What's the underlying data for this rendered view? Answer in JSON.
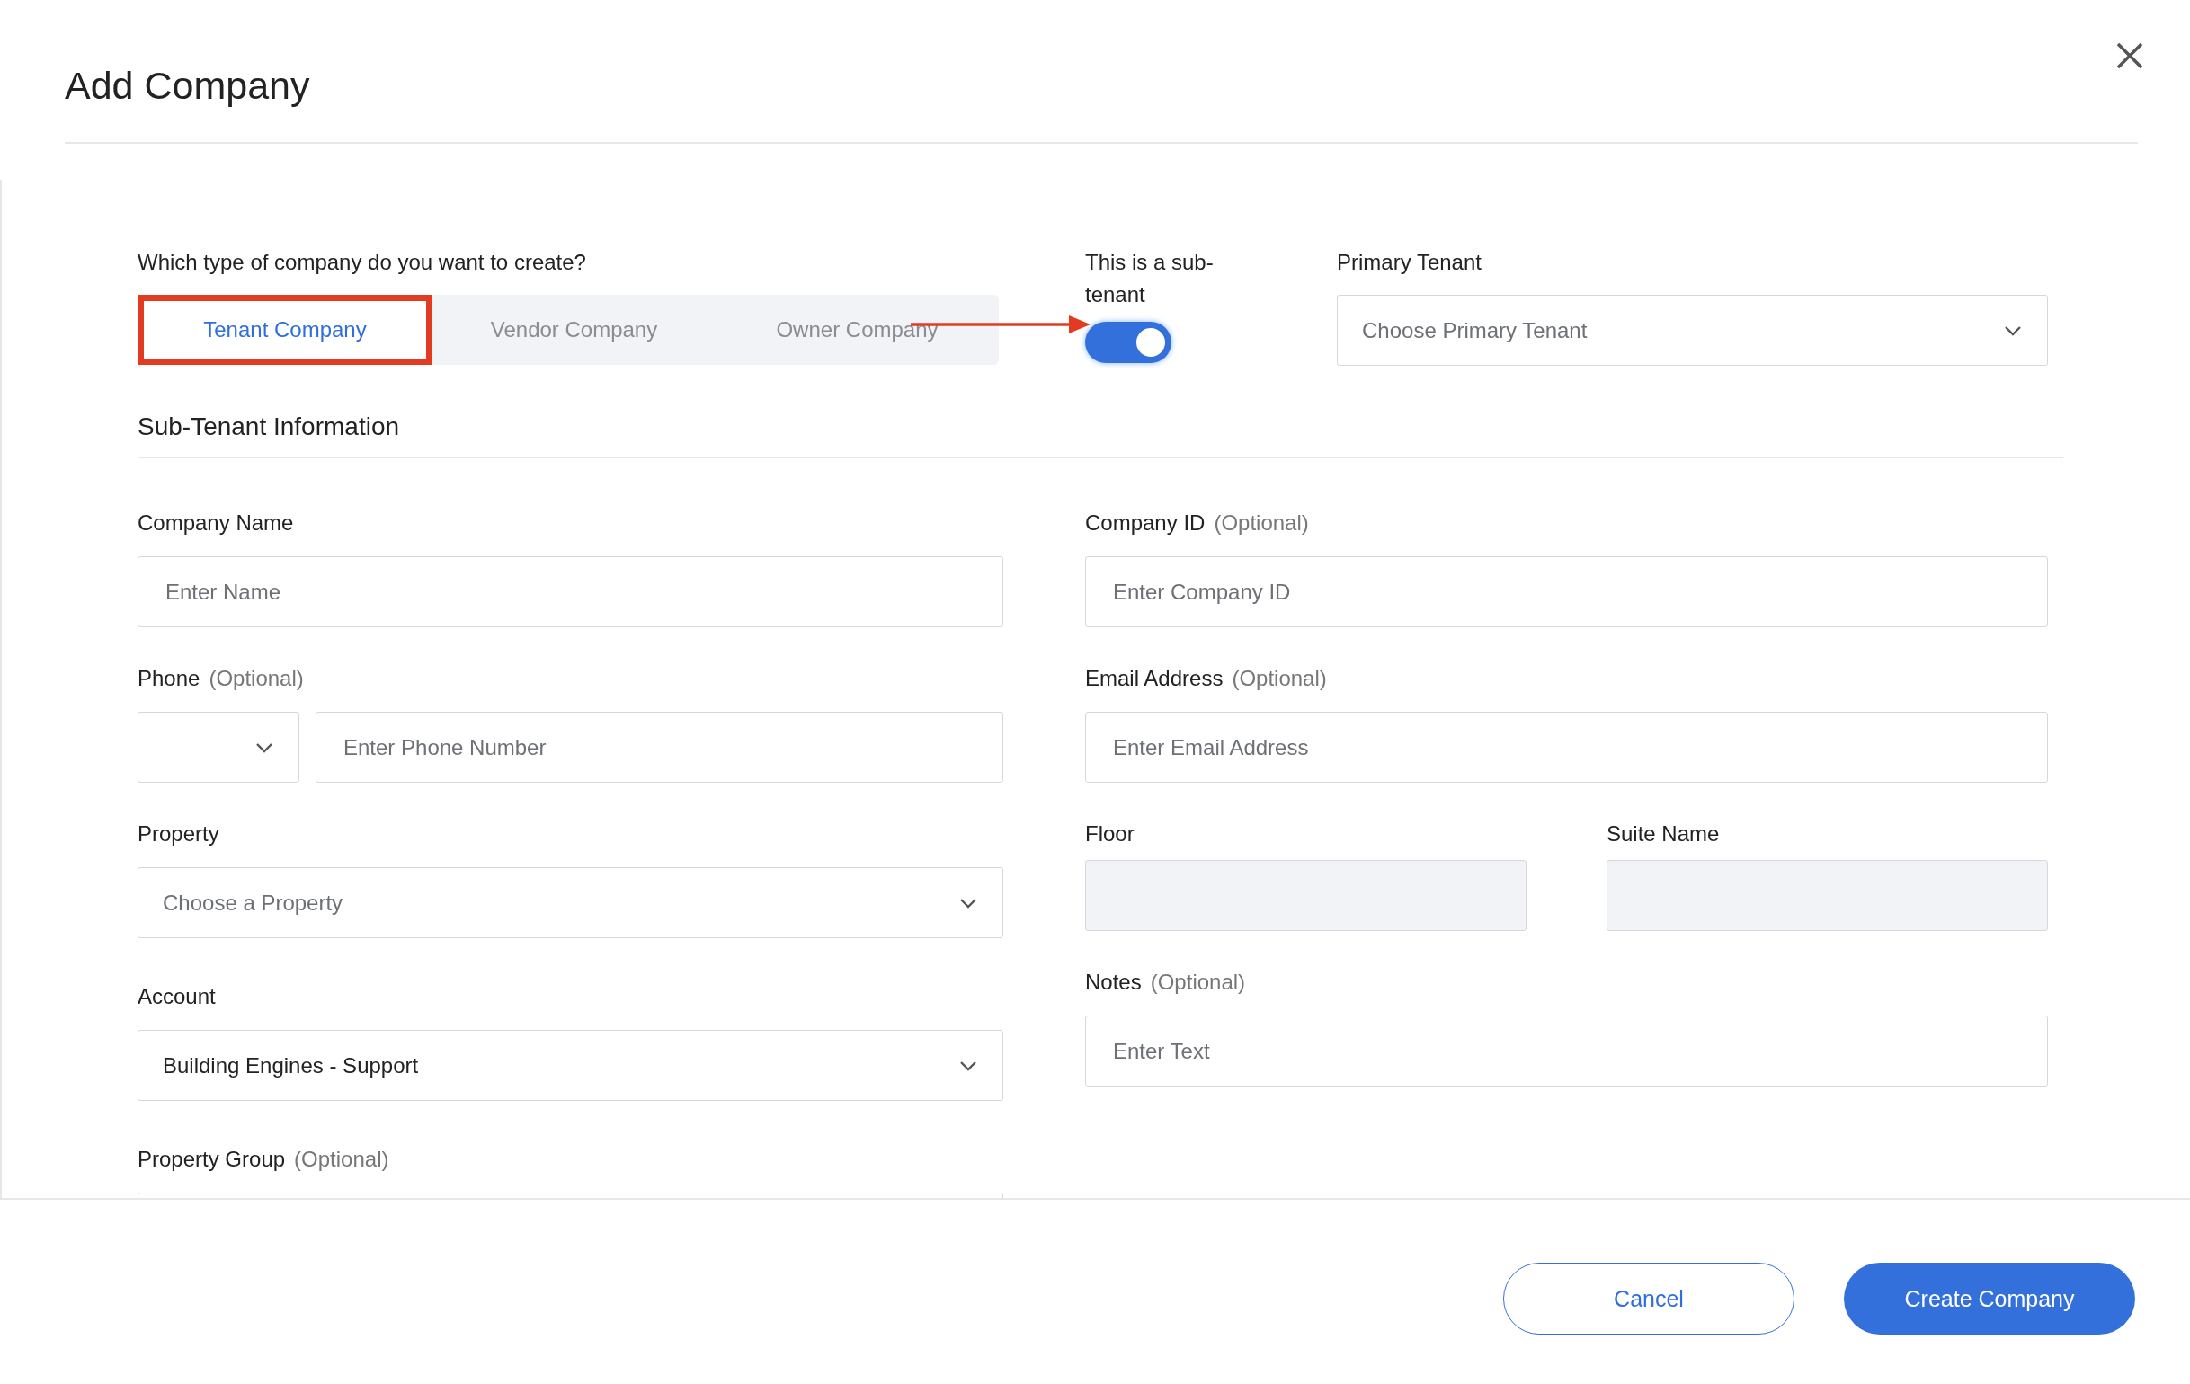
{
  "dialog": {
    "title": "Add Company"
  },
  "company_type": {
    "question": "Which type of company do you want to create?",
    "tabs": [
      {
        "label": "Tenant Company",
        "selected": true
      },
      {
        "label": "Vendor Company",
        "selected": false
      },
      {
        "label": "Owner Company",
        "selected": false
      }
    ]
  },
  "sub_tenant": {
    "label": "This is a sub-tenant",
    "on": true
  },
  "primary_tenant": {
    "label": "Primary Tenant",
    "placeholder": "Choose Primary Tenant"
  },
  "section_title": "Sub-Tenant Information",
  "left_fields": [
    {
      "kind": "text",
      "label": "Company Name",
      "placeholder": "Enter Name",
      "disabled": false
    },
    {
      "kind": "phone",
      "label": "Phone",
      "optional": "(Optional)",
      "placeholder": "Enter Phone Number",
      "disabled": false
    },
    {
      "kind": "select",
      "label": "Property",
      "placeholder": "Choose a Property"
    },
    {
      "kind": "select",
      "label": "Account",
      "value": "Building Engines - Support"
    },
    {
      "kind": "text",
      "label": "Property Group",
      "optional": "(Optional)",
      "disabled": false
    }
  ],
  "right_fields": [
    {
      "kind": "text",
      "label": "Company ID",
      "optional": "(Optional)",
      "placeholder": "Enter Company ID",
      "disabled": false
    },
    {
      "kind": "text",
      "label": "Email Address",
      "optional": "(Optional)",
      "placeholder": "Enter Email Address",
      "disabled": false
    },
    {
      "kind": "pair",
      "fields": [
        {
          "label": "Floor",
          "disabled": true
        },
        {
          "label": "Suite Name",
          "disabled": true
        }
      ]
    },
    {
      "kind": "text",
      "label": "Notes",
      "optional": "(Optional)",
      "placeholder": "Enter Text",
      "disabled": false
    }
  ],
  "buttons": [
    {
      "label": "Cancel",
      "kind": "secondary"
    },
    {
      "label": "Create Company",
      "kind": "primary"
    }
  ]
}
